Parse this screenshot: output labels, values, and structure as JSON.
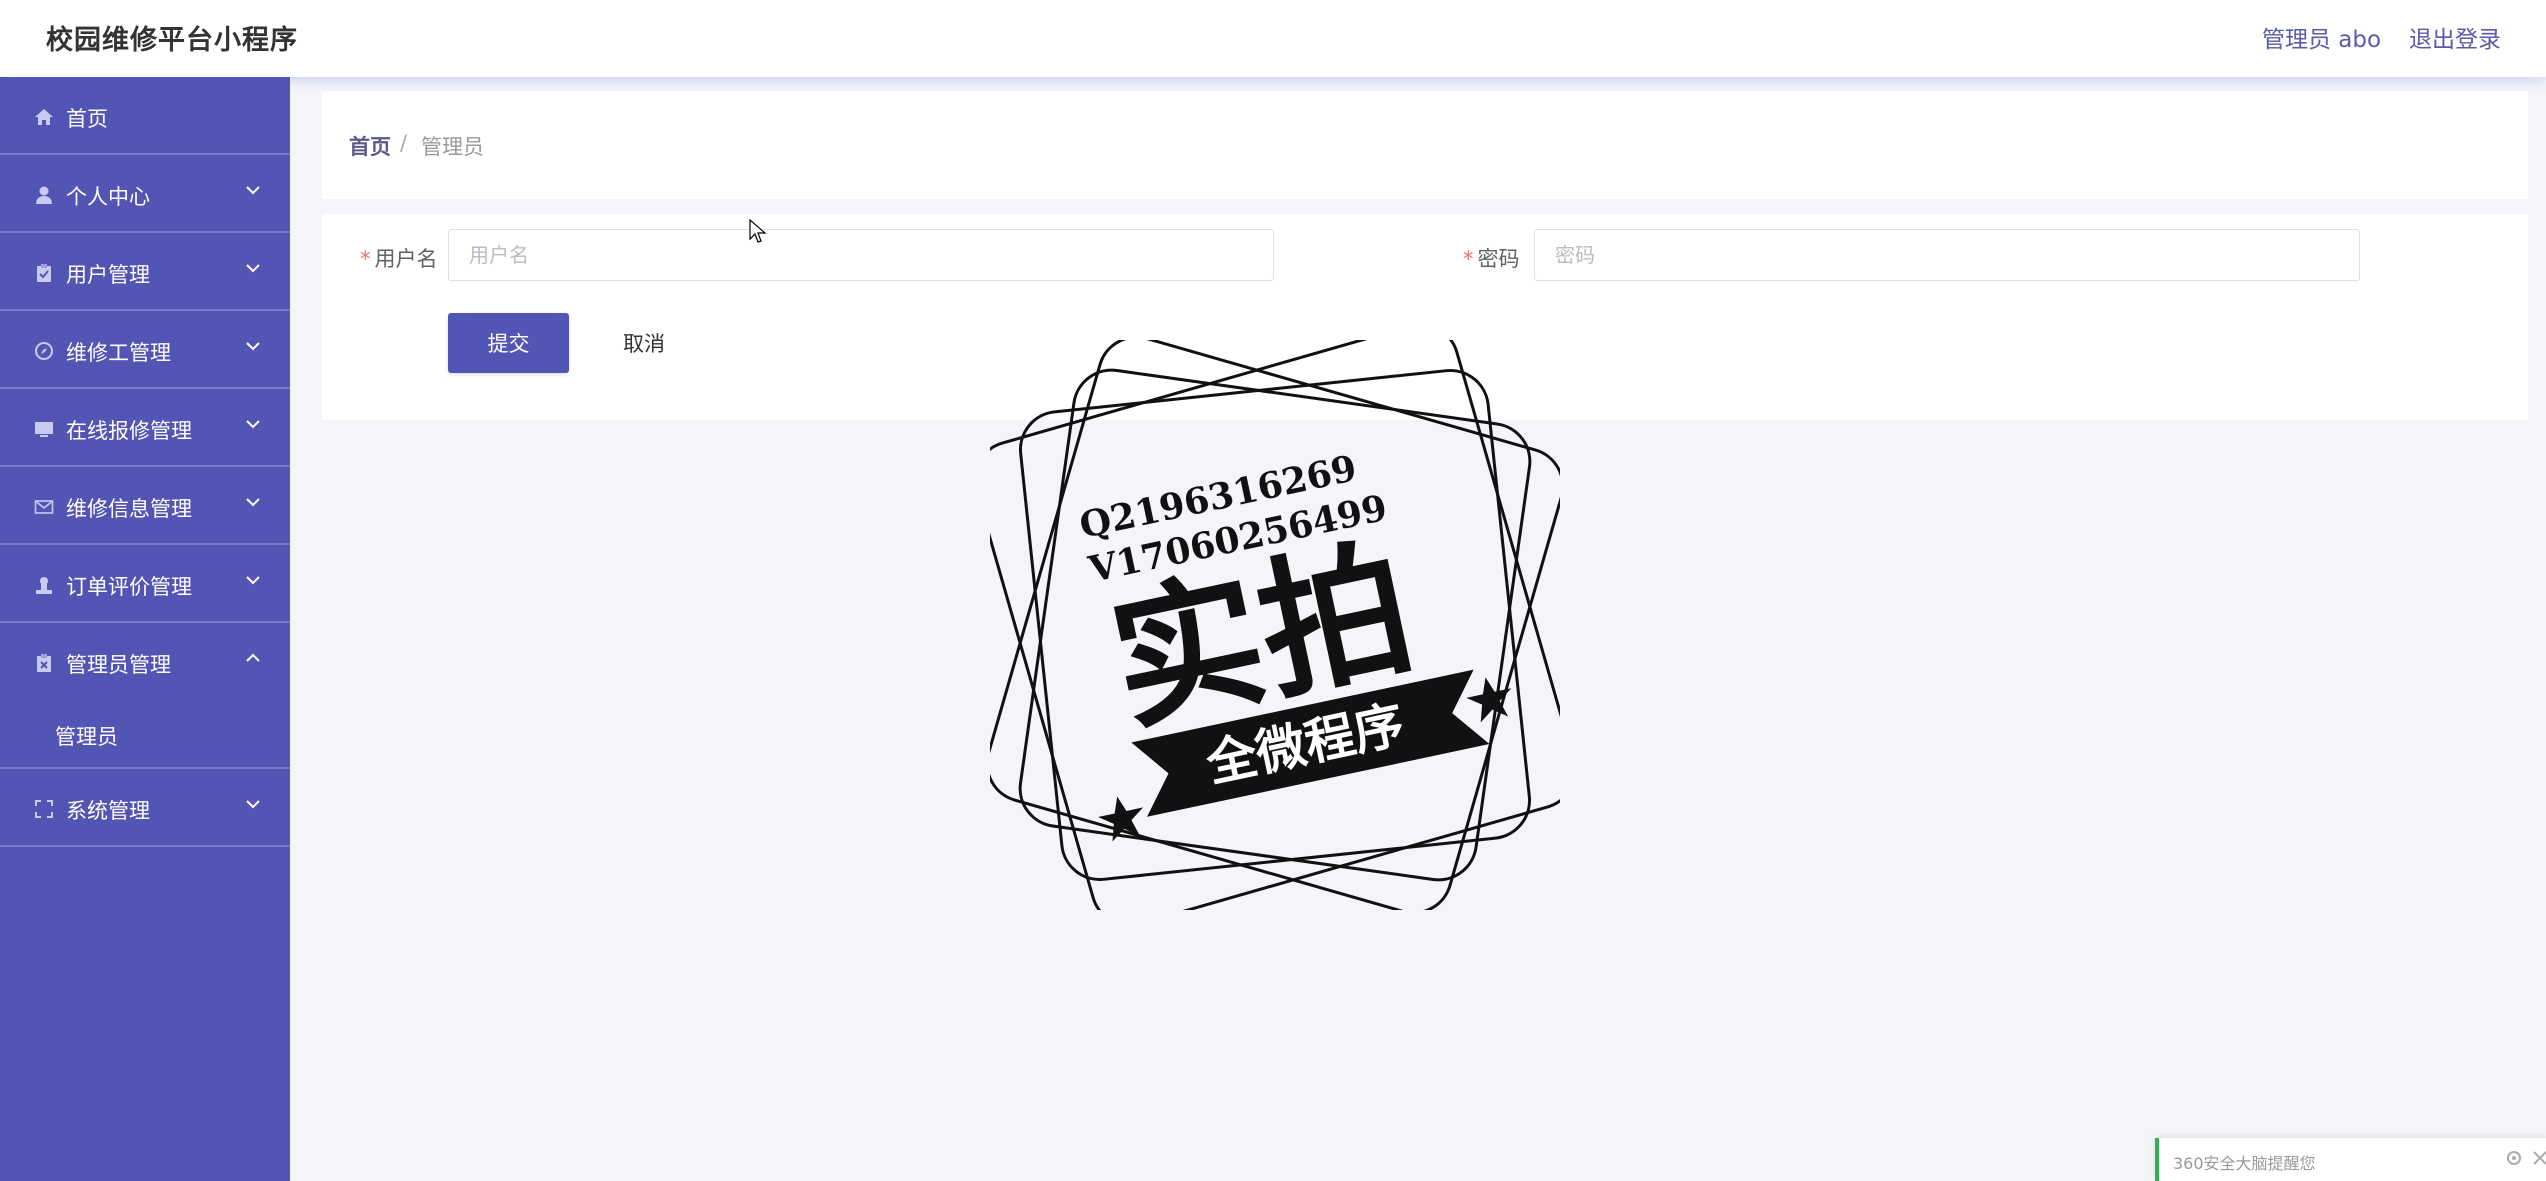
{
  "header": {
    "title": "校园维修平台小程序",
    "user": "管理员 abo",
    "logout": "退出登录"
  },
  "sidebar": {
    "items": [
      {
        "label": "首页",
        "icon": "home-icon",
        "expandable": false
      },
      {
        "label": "个人中心",
        "icon": "user-icon",
        "expandable": true
      },
      {
        "label": "用户管理",
        "icon": "clipboard-icon",
        "expandable": true
      },
      {
        "label": "维修工管理",
        "icon": "compass-icon",
        "expandable": true
      },
      {
        "label": "在线报修管理",
        "icon": "monitor-icon",
        "expandable": true
      },
      {
        "label": "维修信息管理",
        "icon": "mail-icon",
        "expandable": true
      },
      {
        "label": "订单评价管理",
        "icon": "person-stamp-icon",
        "expandable": true
      },
      {
        "label": "管理员管理",
        "icon": "clipboard-x-icon",
        "expandable": true,
        "expanded": true,
        "children": [
          {
            "label": "管理员"
          }
        ]
      },
      {
        "label": "系统管理",
        "icon": "fullscreen-icon",
        "expandable": true
      }
    ]
  },
  "breadcrumb": {
    "home": "首页",
    "separator": "/",
    "current": "管理员"
  },
  "form": {
    "username_label": "用户名",
    "username_placeholder": "用户名",
    "username_value": "",
    "password_label": "密码",
    "password_placeholder": "密码",
    "password_value": "",
    "required_mark": "*",
    "submit": "提交",
    "cancel": "取消"
  },
  "watermark": {
    "line1": "Q2196316269",
    "line2": "V17060256499",
    "main": "实拍",
    "banner": "全微程序"
  },
  "toast": {
    "text": "360安全大脑提醒您"
  },
  "colors": {
    "sidebar_bg": "#5355b4",
    "accent": "#5355b4",
    "page_bg": "#f4f5f9",
    "required": "#f56c6c",
    "toast_border": "#2bb24c"
  }
}
